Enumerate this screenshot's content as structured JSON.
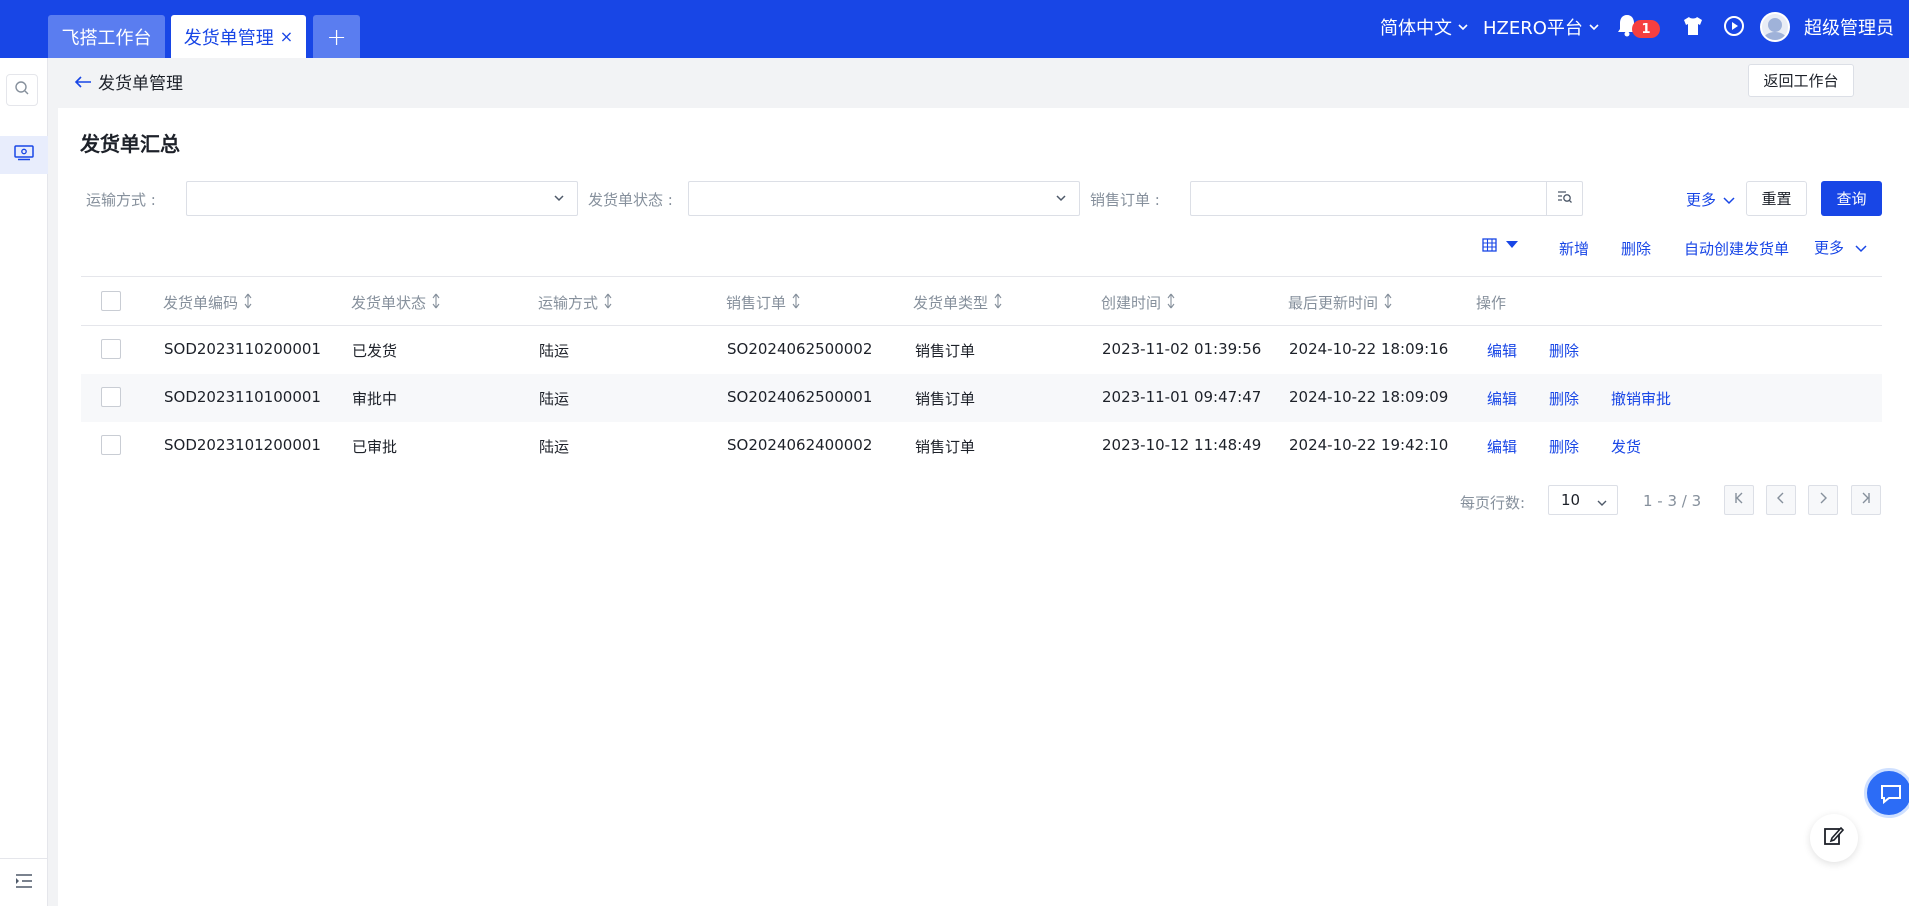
{
  "tabs": [
    {
      "label": "飞搭工作台"
    },
    {
      "label": "发货单管理",
      "close": "×"
    },
    {
      "label": "+"
    }
  ],
  "topbar": {
    "language": "简体中文",
    "platform": "HZERO平台",
    "notification_count": "1",
    "user": "超级管理员"
  },
  "breadcrumb": {
    "title": "发货单管理",
    "back_button": "返回工作台"
  },
  "page": {
    "title": "发货单汇总"
  },
  "filters": {
    "transport_label": "运输方式 :",
    "status_label": "发货单状态 :",
    "sales_order_label": "销售订单 :",
    "more": "更多",
    "reset": "重置",
    "query": "查询"
  },
  "toolbar": {
    "add": "新增",
    "delete": "删除",
    "auto_create": "自动创建发货单",
    "more": "更多"
  },
  "table": {
    "columns": [
      "发货单编码",
      "发货单状态",
      "运输方式",
      "销售订单",
      "发货单类型",
      "创建时间",
      "最后更新时间",
      "操作"
    ],
    "rows": [
      {
        "code": "SOD2023110200001",
        "status": "已发货",
        "transport": "陆运",
        "sales_order": "SO2024062500002",
        "type": "销售订单",
        "created": "2023-11-02 01:39:56",
        "updated": "2024-10-22 18:09:16",
        "ops": [
          "编辑",
          "删除"
        ]
      },
      {
        "code": "SOD2023110100001",
        "status": "审批中",
        "transport": "陆运",
        "sales_order": "SO2024062500001",
        "type": "销售订单",
        "created": "2023-11-01 09:47:47",
        "updated": "2024-10-22 18:09:09",
        "ops": [
          "编辑",
          "删除",
          "撤销审批"
        ]
      },
      {
        "code": "SOD2023101200001",
        "status": "已审批",
        "transport": "陆运",
        "sales_order": "SO2024062400002",
        "type": "销售订单",
        "created": "2023-10-12 11:48:49",
        "updated": "2024-10-22 19:42:10",
        "ops": [
          "编辑",
          "删除",
          "发货"
        ]
      }
    ]
  },
  "pagination": {
    "page_size_label": "每页行数:",
    "page_size": "10",
    "range": "1 - 3 / 3"
  }
}
